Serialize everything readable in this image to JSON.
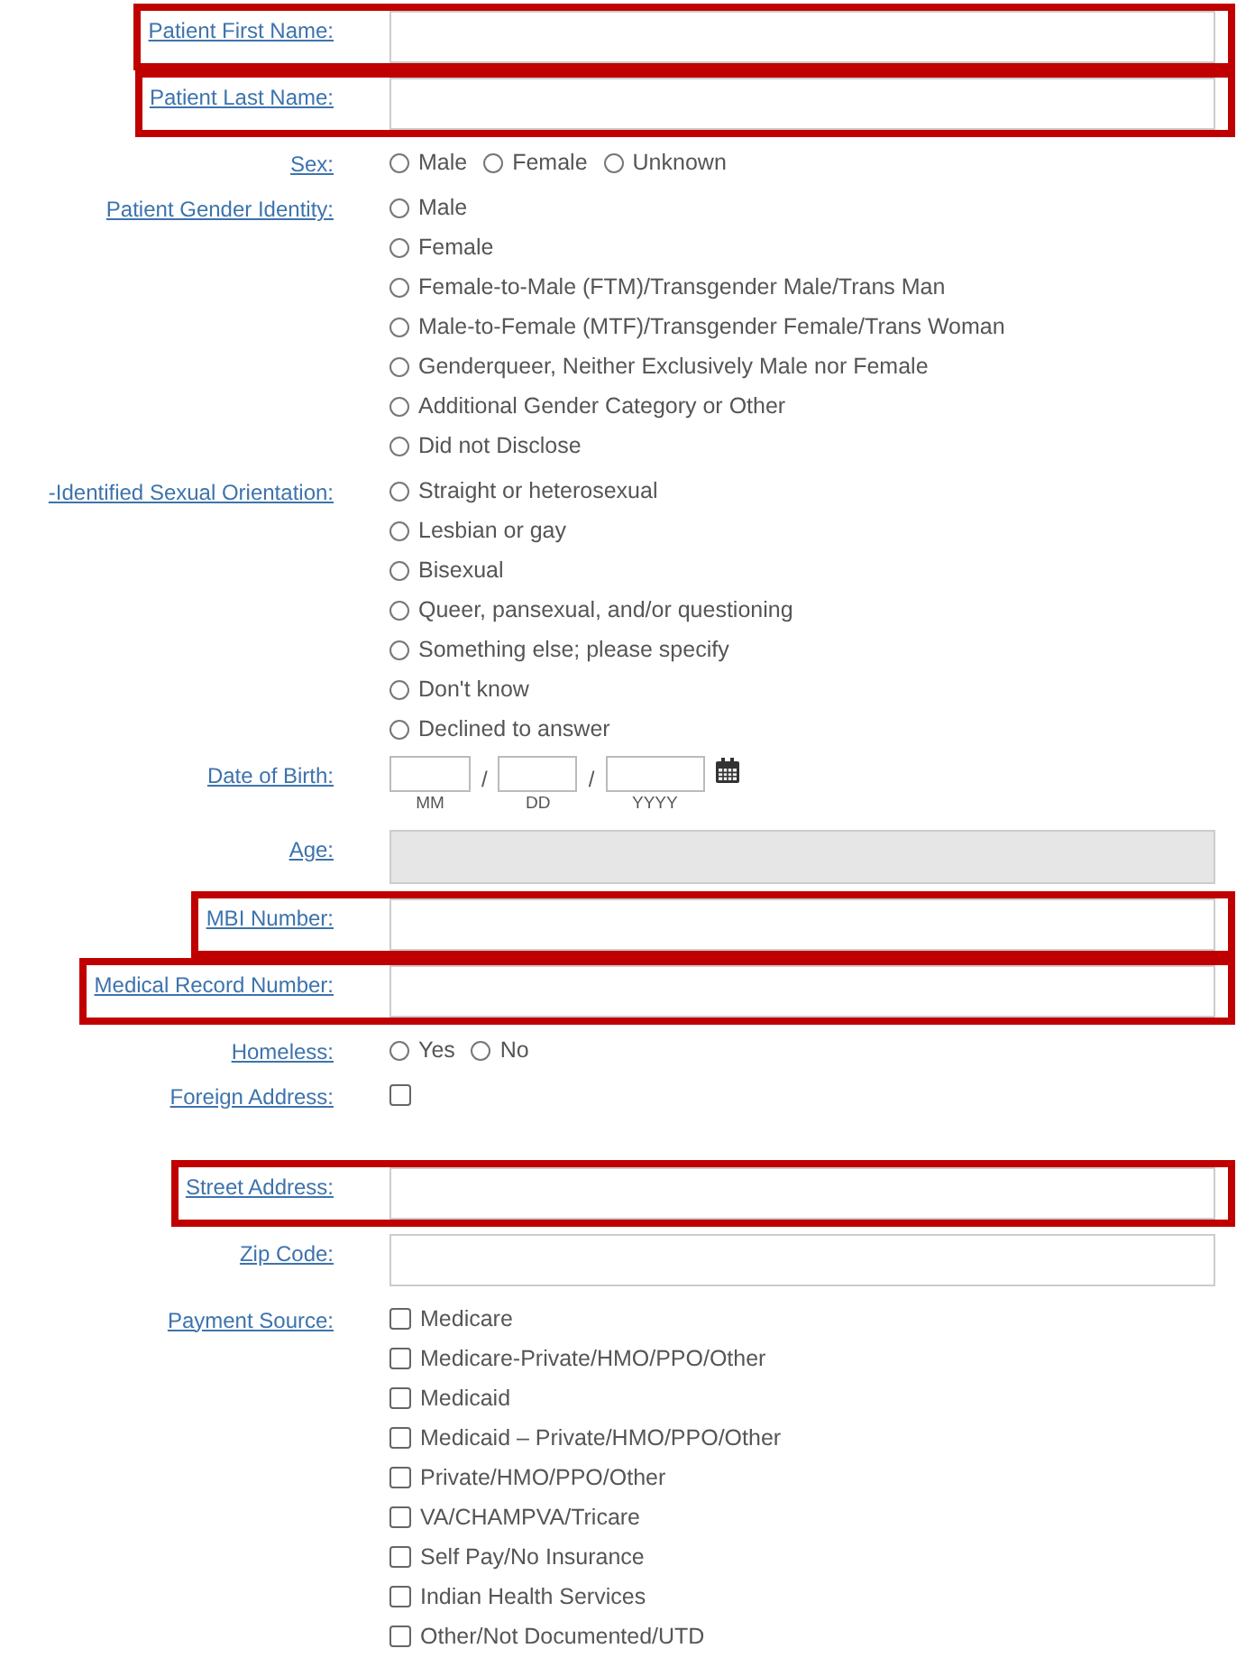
{
  "sections": [
    {
      "rows": [
        {
          "kind": "text",
          "label": "Patient First Name:",
          "highlighted": true
        },
        {
          "kind": "text",
          "label": "Patient Last Name:",
          "highlighted": true
        },
        {
          "kind": "radio_inline",
          "label": "Sex:",
          "highlighted": false,
          "options": [
            {
              "label": "Male",
              "selected": false
            },
            {
              "label": "Female",
              "selected": false
            },
            {
              "label": "Unknown",
              "selected": false
            }
          ]
        },
        {
          "kind": "radio_list",
          "label": "Patient Gender Identity:",
          "highlighted": false,
          "options": [
            {
              "label": "Male",
              "selected": false
            },
            {
              "label": "Female",
              "selected": false
            },
            {
              "label": "Female-to-Male (FTM)/Transgender Male/Trans Man",
              "selected": false
            },
            {
              "label": "Male-to-Female (MTF)/Transgender Female/Trans Woman",
              "selected": false
            },
            {
              "label": "Genderqueer, Neither Exclusively Male nor Female",
              "selected": false
            },
            {
              "label": "Additional Gender Category or Other",
              "selected": false
            },
            {
              "label": "Did not Disclose",
              "selected": false
            }
          ]
        },
        {
          "kind": "radio_list",
          "label": "-Identified Sexual Orientation:",
          "highlighted": false,
          "options": [
            {
              "label": "Straight or heterosexual",
              "selected": false
            },
            {
              "label": "Lesbian or gay",
              "selected": false
            },
            {
              "label": "Bisexual",
              "selected": false
            },
            {
              "label": "Queer, pansexual, and/or questioning",
              "selected": false
            },
            {
              "label": "Something else; please specify",
              "selected": false
            },
            {
              "label": "Don't know",
              "selected": false
            },
            {
              "label": "Declined to answer",
              "selected": false
            }
          ]
        },
        {
          "kind": "date",
          "label": "Date of Birth:",
          "highlighted": false,
          "separators": [
            "/",
            "/"
          ],
          "parts": [
            "MM",
            "DD",
            "YYYY"
          ]
        },
        {
          "kind": "readonly",
          "label": "Age:",
          "highlighted": false
        },
        {
          "kind": "text",
          "label": "MBI Number:",
          "highlighted": true
        },
        {
          "kind": "text",
          "label": "Medical Record Number:",
          "highlighted": true
        },
        {
          "kind": "radio_inline",
          "label": "Homeless:",
          "highlighted": false,
          "options": [
            {
              "label": "Yes",
              "selected": false
            },
            {
              "label": "No",
              "selected": false
            }
          ]
        },
        {
          "kind": "checkbox",
          "label": "Foreign Address:",
          "highlighted": false,
          "checked": false
        }
      ]
    },
    {
      "rows": [
        {
          "kind": "text",
          "label": "Street Address:",
          "highlighted": true
        },
        {
          "kind": "text",
          "label": "Zip Code:",
          "highlighted": false
        },
        {
          "kind": "checkbox_list",
          "label": "Payment Source:",
          "highlighted": false,
          "options": [
            {
              "label": "Medicare",
              "checked": false
            },
            {
              "label": "Medicare-Private/HMO/PPO/Other",
              "checked": false
            },
            {
              "label": "Medicaid",
              "checked": false
            },
            {
              "label": "Medicaid – Private/HMO/PPO/Other",
              "checked": false
            },
            {
              "label": "Private/HMO/PPO/Other",
              "checked": false
            },
            {
              "label": "VA/CHAMPVA/Tricare",
              "checked": false
            },
            {
              "label": "Self Pay/No Insurance",
              "checked": false
            },
            {
              "label": "Indian Health Services",
              "checked": false
            },
            {
              "label": "Other/Not Documented/UTD",
              "checked": false
            }
          ]
        }
      ]
    }
  ]
}
